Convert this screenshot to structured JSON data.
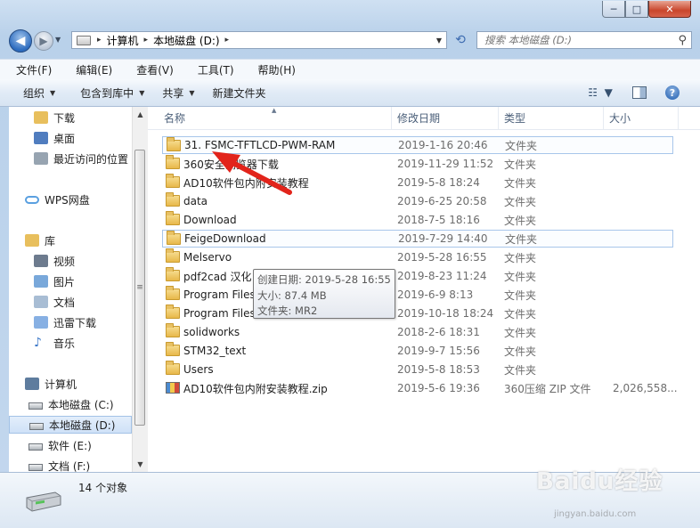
{
  "window": {
    "minimize_glyph": "─",
    "maximize_glyph": "□",
    "close_glyph": "✕"
  },
  "address_bar": {
    "segments": [
      "计算机",
      "本地磁盘 (D:)"
    ],
    "separator": "▸"
  },
  "search": {
    "placeholder": "搜索 本地磁盘 (D:)"
  },
  "menu": [
    "文件(F)",
    "编辑(E)",
    "查看(V)",
    "工具(T)",
    "帮助(H)"
  ],
  "toolbar": {
    "organize": "组织",
    "include_in_library": "包含到库中",
    "share": "共享",
    "new_folder": "新建文件夹"
  },
  "nav_pane": {
    "items": [
      {
        "label": "下载",
        "icon": "downloads-icon"
      },
      {
        "label": "桌面",
        "icon": "desktop-icon"
      },
      {
        "label": "最近访问的位置",
        "icon": "recent-places-icon"
      },
      {
        "label": "WPS网盘",
        "icon": "cloud-icon"
      },
      {
        "label": "库",
        "icon": "library-icon"
      },
      {
        "label": "视频",
        "icon": "video-icon"
      },
      {
        "label": "图片",
        "icon": "pictures-icon"
      },
      {
        "label": "文档",
        "icon": "documents-icon"
      },
      {
        "label": "迅雷下载",
        "icon": "thunder-download-icon"
      },
      {
        "label": "音乐",
        "icon": "music-icon"
      },
      {
        "label": "计算机",
        "icon": "computer-icon"
      },
      {
        "label": "本地磁盘 (C:)",
        "icon": "drive-c-icon"
      },
      {
        "label": "本地磁盘 (D:)",
        "icon": "drive-d-icon",
        "selected": true
      },
      {
        "label": "软件 (E:)",
        "icon": "drive-e-icon"
      },
      {
        "label": "文档 (F:)",
        "icon": "drive-f-icon"
      }
    ]
  },
  "columns": {
    "name": "名称",
    "date": "修改日期",
    "type": "类型",
    "size": "大小"
  },
  "files": [
    {
      "name": "31. FSMC-TFTLCD-PWM-RAM",
      "date": "2019-1-16 20:46",
      "type": "文件夹",
      "size": "",
      "kind": "folder"
    },
    {
      "name": "360安全浏览器下载",
      "date": "2019-11-29 11:52",
      "type": "文件夹",
      "size": "",
      "kind": "folder"
    },
    {
      "name": "AD10软件包内附安装教程",
      "date": "2019-5-8 18:24",
      "type": "文件夹",
      "size": "",
      "kind": "folder"
    },
    {
      "name": "data",
      "date": "2019-6-25 20:58",
      "type": "文件夹",
      "size": "",
      "kind": "folder"
    },
    {
      "name": "Download",
      "date": "2018-7-5 18:16",
      "type": "文件夹",
      "size": "",
      "kind": "folder"
    },
    {
      "name": "FeigeDownload",
      "date": "2019-7-29 14:40",
      "type": "文件夹",
      "size": "",
      "kind": "folder"
    },
    {
      "name": "Melservo",
      "date": "2019-5-28 16:55",
      "type": "文件夹",
      "size": "",
      "kind": "folder"
    },
    {
      "name": "pdf2cad 汉化",
      "date": "2019-8-23 11:24",
      "type": "文件夹",
      "size": "",
      "kind": "folder"
    },
    {
      "name": "Program Files",
      "date": "2019-6-9 8:13",
      "type": "文件夹",
      "size": "",
      "kind": "folder"
    },
    {
      "name": "Program Files",
      "date": "2019-10-18 18:24",
      "type": "文件夹",
      "size": "",
      "kind": "folder"
    },
    {
      "name": "solidworks",
      "date": "2018-2-6 18:31",
      "type": "文件夹",
      "size": "",
      "kind": "folder"
    },
    {
      "name": "STM32_text",
      "date": "2019-9-7 15:56",
      "type": "文件夹",
      "size": "",
      "kind": "folder"
    },
    {
      "name": "Users",
      "date": "2019-5-8 18:53",
      "type": "文件夹",
      "size": "",
      "kind": "folder"
    },
    {
      "name": "AD10软件包内附安装教程.zip",
      "date": "2019-5-6 19:36",
      "type": "360压缩 ZIP 文件",
      "size": "2,026,558...",
      "kind": "zip"
    }
  ],
  "tooltip": {
    "created": "创建日期: 2019-5-28 16:55",
    "size": "大小: 87.4 MB",
    "folders": "文件夹: MR2"
  },
  "status": {
    "count": "14 个对象"
  },
  "watermark": {
    "brand": "Baidu经验",
    "url": "jingyan.baidu.com"
  },
  "colors": {
    "annotation_arrow": "#e2241b",
    "selection": "#a8c6ea",
    "window_frame": "#b9d1ea"
  }
}
